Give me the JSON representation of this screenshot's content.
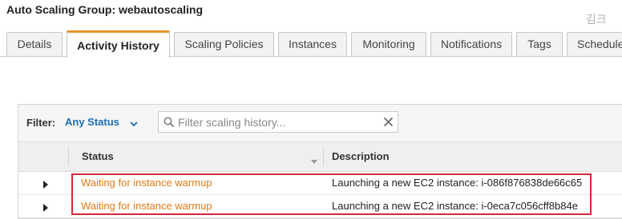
{
  "page": {
    "title": "Auto Scaling Group: webautoscaling",
    "watermark": "김크"
  },
  "tabs": [
    {
      "label": "Details",
      "active": false
    },
    {
      "label": "Activity History",
      "active": true
    },
    {
      "label": "Scaling Policies",
      "active": false
    },
    {
      "label": "Instances",
      "active": false
    },
    {
      "label": "Monitoring",
      "active": false
    },
    {
      "label": "Notifications",
      "active": false
    },
    {
      "label": "Tags",
      "active": false
    },
    {
      "label": "Scheduled Actions",
      "active": false
    }
  ],
  "filter": {
    "label": "Filter:",
    "selected": "Any Status",
    "search_placeholder": "Filter scaling history..."
  },
  "table": {
    "columns": [
      "Status",
      "Description"
    ],
    "rows": [
      {
        "status": "Waiting for instance warmup",
        "description": "Launching a new EC2 instance: i-086f876838de66c65"
      },
      {
        "status": "Waiting for instance warmup",
        "description": "Launching a new EC2 instance: i-0eca7c056cff8b84e"
      }
    ]
  },
  "colors": {
    "active_tab_accent": "#e7932a",
    "status_text": "#e07b14",
    "filter_link": "#1a6eb4",
    "highlight_box": "#d7283a"
  }
}
